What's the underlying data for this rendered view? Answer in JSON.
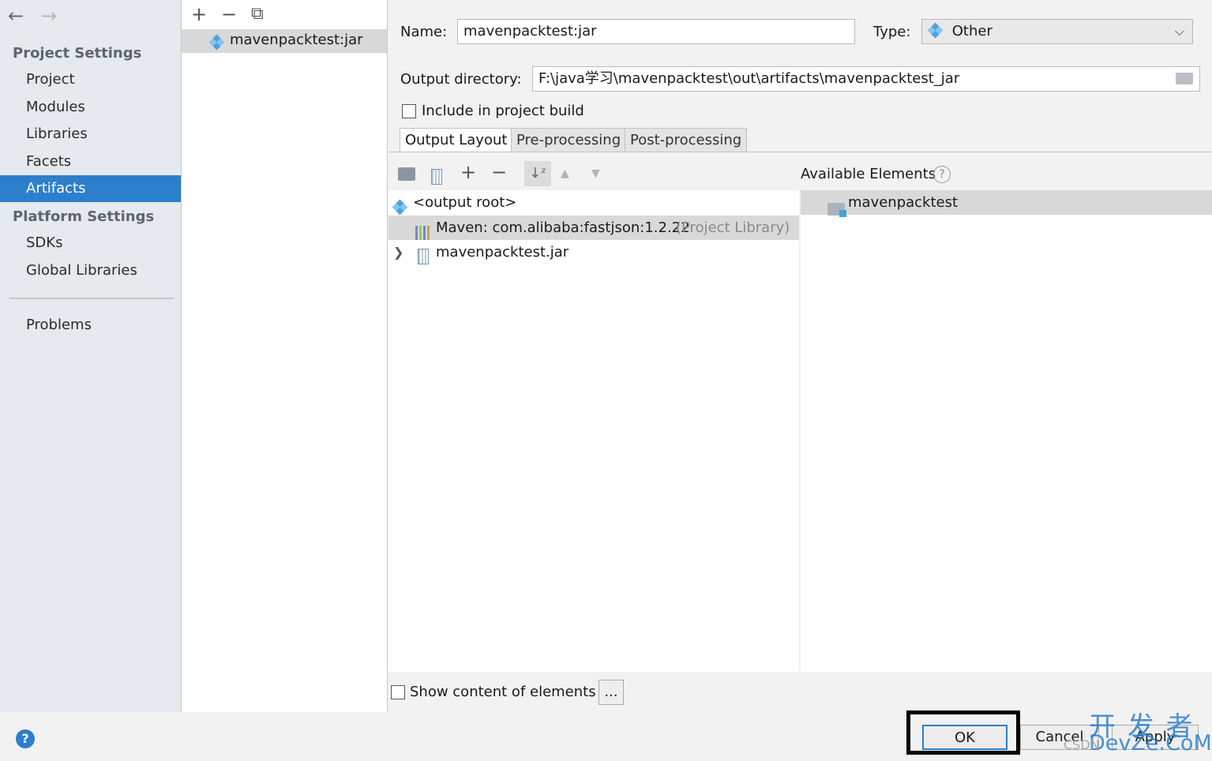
{
  "sidebar": {
    "back": "←",
    "forward": "→",
    "project_settings_heading": "Project Settings",
    "project_items": [
      "Project",
      "Modules",
      "Libraries",
      "Facets",
      "Artifacts"
    ],
    "platform_settings_heading": "Platform Settings",
    "platform_items": [
      "SDKs",
      "Global Libraries"
    ],
    "problems": "Problems",
    "selected": "Artifacts"
  },
  "artifacts_list": {
    "add": "+",
    "remove": "−",
    "copy": "⧉",
    "items": [
      "mavenpacktest:jar"
    ]
  },
  "form": {
    "name_label": "Name:",
    "name_value": "mavenpacktest:jar",
    "type_label": "Type:",
    "type_value": "Other",
    "output_dir_label": "Output directory:",
    "output_dir_value": "F:\\java学习\\mavenpacktest\\out\\artifacts\\mavenpacktest_jar",
    "include_build_label": "Include in project build"
  },
  "tabs": [
    "Output Layout",
    "Pre-processing",
    "Post-processing"
  ],
  "layout": {
    "tree": [
      {
        "label": "<output root>",
        "suffix": ""
      },
      {
        "label": "Maven: com.alibaba:fastjson:1.2.22",
        "suffix": "(Project Library)"
      },
      {
        "label": "mavenpacktest.jar",
        "suffix": ""
      }
    ],
    "available_elements_label": "Available Elements",
    "available_items": [
      "mavenpacktest"
    ],
    "show_content_label": "Show content of elements",
    "browse": "..."
  },
  "footer": {
    "help": "?",
    "ok": "OK",
    "cancel": "Cancel",
    "apply": "Apply",
    "watermark_main": "开 发 者",
    "watermark_sub": "DevZe.CoM",
    "watermark_csdn": "CSDN"
  },
  "colors": {
    "selection": "#2c7fcd",
    "highlight_box": "#000000"
  }
}
